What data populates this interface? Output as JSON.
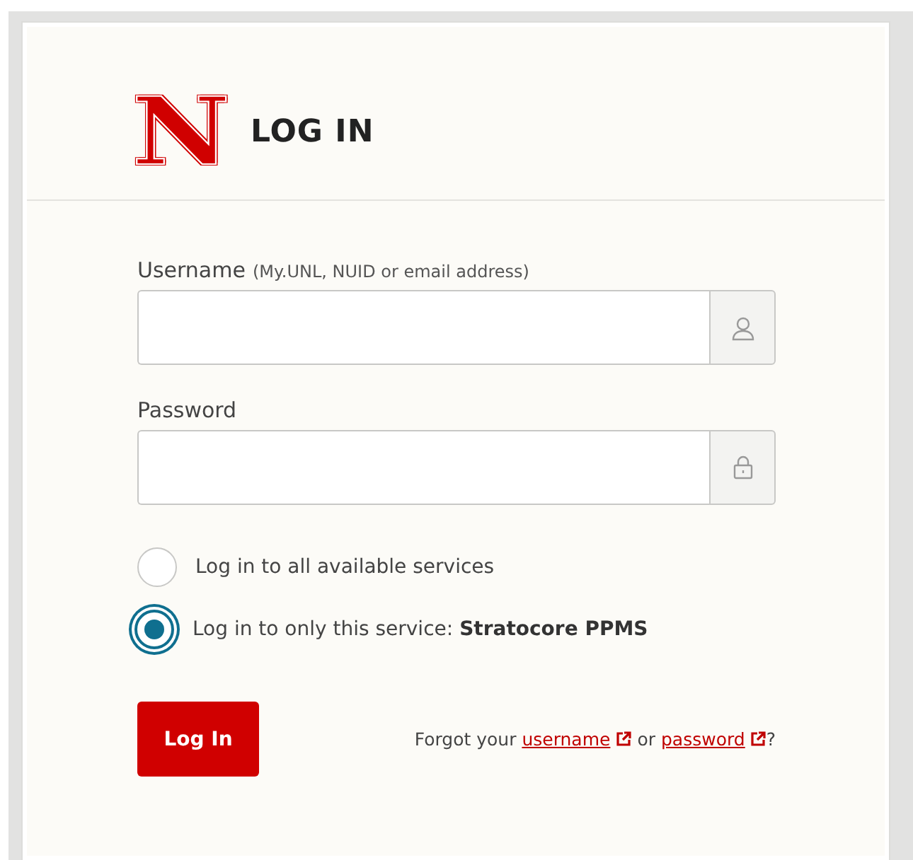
{
  "header": {
    "logo": "N",
    "title": "LOG IN"
  },
  "fields": [
    {
      "kind": "user",
      "label": "Username",
      "hint": "(My.UNL, NUID or email address)"
    },
    {
      "kind": "lock",
      "label": "Password"
    }
  ],
  "options": [
    {
      "text": "Log in to all available services",
      "selected": false
    },
    {
      "text": "Log in to only this service: **Stratocore PPMS**",
      "selected": true
    }
  ],
  "submit": "Log In",
  "forgot": {
    "prefix": "Forgot your",
    "links": [
      "username",
      "password"
    ],
    "joiner": "or",
    "suffix": "?"
  }
}
